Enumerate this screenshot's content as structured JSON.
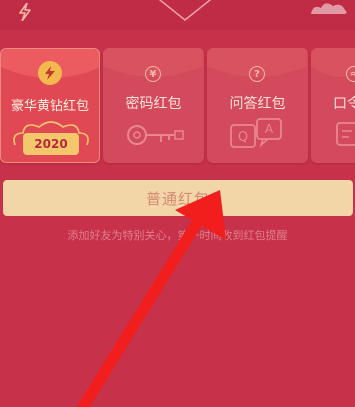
{
  "cards": [
    {
      "label": "豪华黄钻红包",
      "year": "2020",
      "icon": "lightning-badge-icon"
    },
    {
      "label": "密码红包",
      "icon": "key-icon"
    },
    {
      "label": "问答红包",
      "icon": "question-icon"
    },
    {
      "label": "口令",
      "icon": "voice-icon"
    }
  ],
  "button": {
    "label": "普通红包"
  },
  "hint": "添加好友为特别关心，第一时间收到红包提醒",
  "colors": {
    "background": "#c8314a",
    "card": "#d24a5c",
    "button": "#f2d6a7",
    "arrow": "#f21d1d"
  }
}
